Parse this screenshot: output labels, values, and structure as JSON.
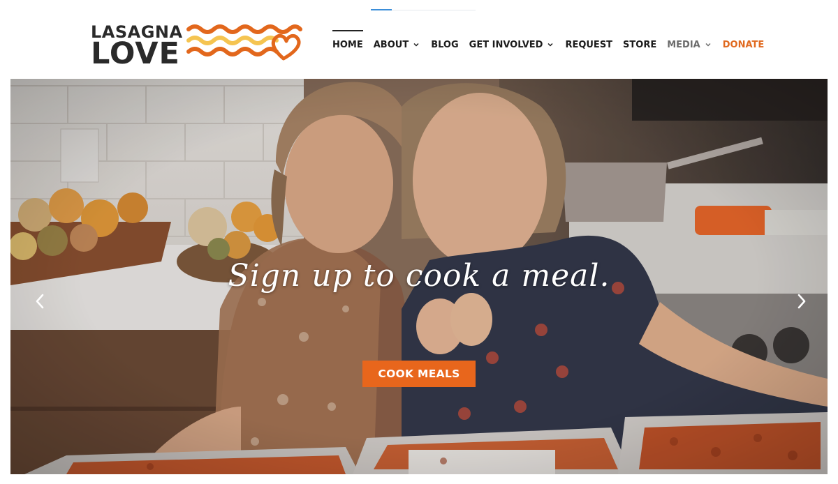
{
  "colors": {
    "accent": "#e8661c",
    "donate": "#e0691f",
    "text": "#1c1c1c",
    "logo_dark": "#2a2a2a",
    "logo_orange": "#e2671c",
    "logo_yellow": "#f5c451"
  },
  "header": {
    "logo": {
      "line1": "LASAGNA",
      "line2": "LOVE"
    },
    "nav": [
      {
        "label": "HOME",
        "current": true,
        "has_dropdown": false
      },
      {
        "label": "ABOUT",
        "current": false,
        "has_dropdown": true
      },
      {
        "label": "BLOG",
        "current": false,
        "has_dropdown": false
      },
      {
        "label": "GET INVOLVED",
        "current": false,
        "has_dropdown": true
      },
      {
        "label": "REQUEST",
        "current": false,
        "has_dropdown": false
      },
      {
        "label": "STORE",
        "current": false,
        "has_dropdown": false
      },
      {
        "label": "MEDIA",
        "current": false,
        "has_dropdown": true
      },
      {
        "label": "DONATE",
        "current": false,
        "has_dropdown": false
      }
    ]
  },
  "loading_progress": 0.2,
  "hero": {
    "headline": "Sign up to cook a meal.",
    "cta_label": "COOK MEALS",
    "icons": {
      "prev": "chevron-left-icon",
      "next": "chevron-right-icon"
    }
  }
}
